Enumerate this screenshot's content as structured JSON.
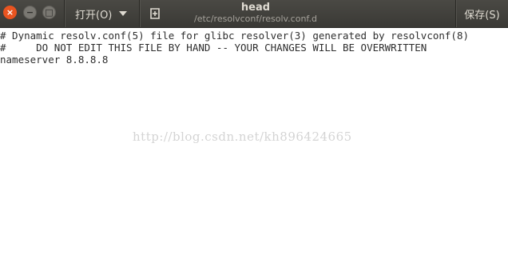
{
  "window": {
    "title": "head",
    "subtitle": "/etc/resolvconf/resolv.conf.d",
    "close_glyph": "×",
    "minimize_glyph": "−",
    "maximize_glyph": "□"
  },
  "toolbar": {
    "open_label": "打开(O)",
    "new_tab_icon": "new-document-icon",
    "save_label": "保存(S)"
  },
  "editor": {
    "lines": [
      "# Dynamic resolv.conf(5) file for glibc resolver(3) generated by resolvconf(8)",
      "#     DO NOT EDIT THIS FILE BY HAND -- YOUR CHANGES WILL BE OVERWRITTEN",
      "nameserver 8.8.8.8"
    ],
    "watermark": "http://blog.csdn.net/kh896424665"
  },
  "colors": {
    "titlebar": "#3c3b37",
    "close_button": "#e95420",
    "editor_bg": "#ffffff"
  }
}
